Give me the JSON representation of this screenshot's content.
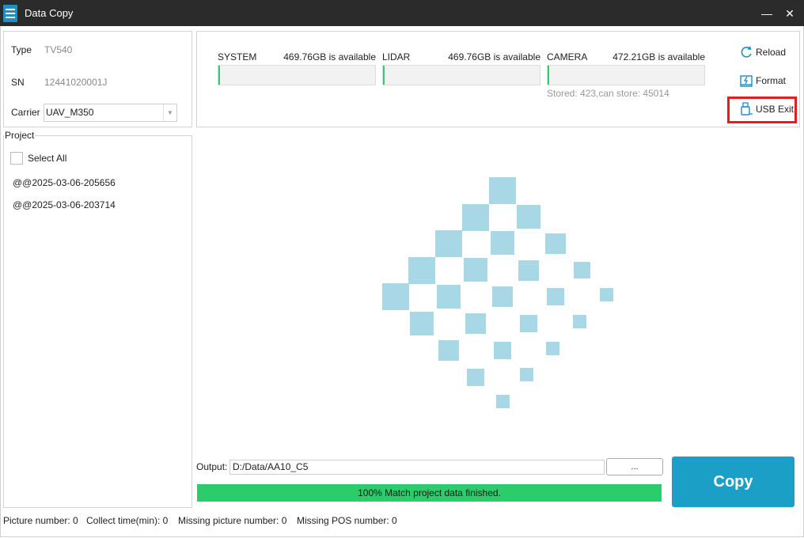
{
  "window": {
    "title": "Data Copy",
    "minimize_label": "—",
    "close_label": "✕"
  },
  "device": {
    "type_label": "Type",
    "type_value": "TV540",
    "sn_label": "SN",
    "sn_value": "12441020001J",
    "carrier_label": "Carrier",
    "carrier_value": "UAV_M350"
  },
  "project": {
    "legend": "Project",
    "select_all_label": "Select All",
    "items": [
      "@@2025-03-06-205656",
      "@@2025-03-06-203714"
    ]
  },
  "storage": [
    {
      "name": "SYSTEM",
      "available": "469.76GB is available",
      "fill_fraction": 0.01
    },
    {
      "name": "LIDAR",
      "available": "469.76GB is available",
      "fill_fraction": 0.01
    },
    {
      "name": "CAMERA",
      "available": "472.21GB is available",
      "fill_fraction": 0.01
    }
  ],
  "stored_text": "Stored: 423,can store: 45014",
  "actions": {
    "reload_label": "Reload",
    "format_label": "Format",
    "usb_exit_label": "USB Exit"
  },
  "output": {
    "label": "Output:",
    "path": "D:/Data/AA10_C5",
    "browse_label": "..."
  },
  "progress": {
    "text": "100% Match project data finished.",
    "value": 1.0
  },
  "copy_label": "Copy",
  "status": {
    "picture_number": "Picture number: 0",
    "collect_time": "Collect time(min): 0",
    "missing_picture": "Missing picture number: 0",
    "missing_pos": "Missing POS number: 0"
  },
  "colors": {
    "titlebar": "#2b2b2b",
    "accent_copy": "#1b9fc6",
    "progress_green": "#2bcc6b",
    "loader_square": "#a8d8e6",
    "highlight_red": "#e02020"
  }
}
